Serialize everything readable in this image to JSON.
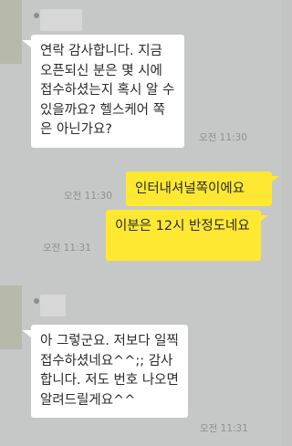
{
  "messages": [
    {
      "direction": "in",
      "text": "연락 감사합니다. 지금 오픈되신 분은 몇 시에 접수하셨는지 혹시 알 수 있을까요? 헬스케어 쪽은 아닌가요?",
      "time": "오전 11:30"
    },
    {
      "direction": "out",
      "text": "인터내셔널쪽이에요",
      "time": "오전 11:30"
    },
    {
      "direction": "out",
      "text": "이분은 12시 반정도네요",
      "time": "오전 11:31"
    },
    {
      "direction": "in",
      "text": "아 그렇군요. 저보다 일찍 접수하셨네요^^;; 감사합니다. 저도 번호 나오면 알려드릴게요^^",
      "time": "오전 11:31"
    }
  ],
  "colors": {
    "incoming_bubble": "#ffffff",
    "outgoing_bubble": "#fee832",
    "background": "#c6c7c7"
  }
}
